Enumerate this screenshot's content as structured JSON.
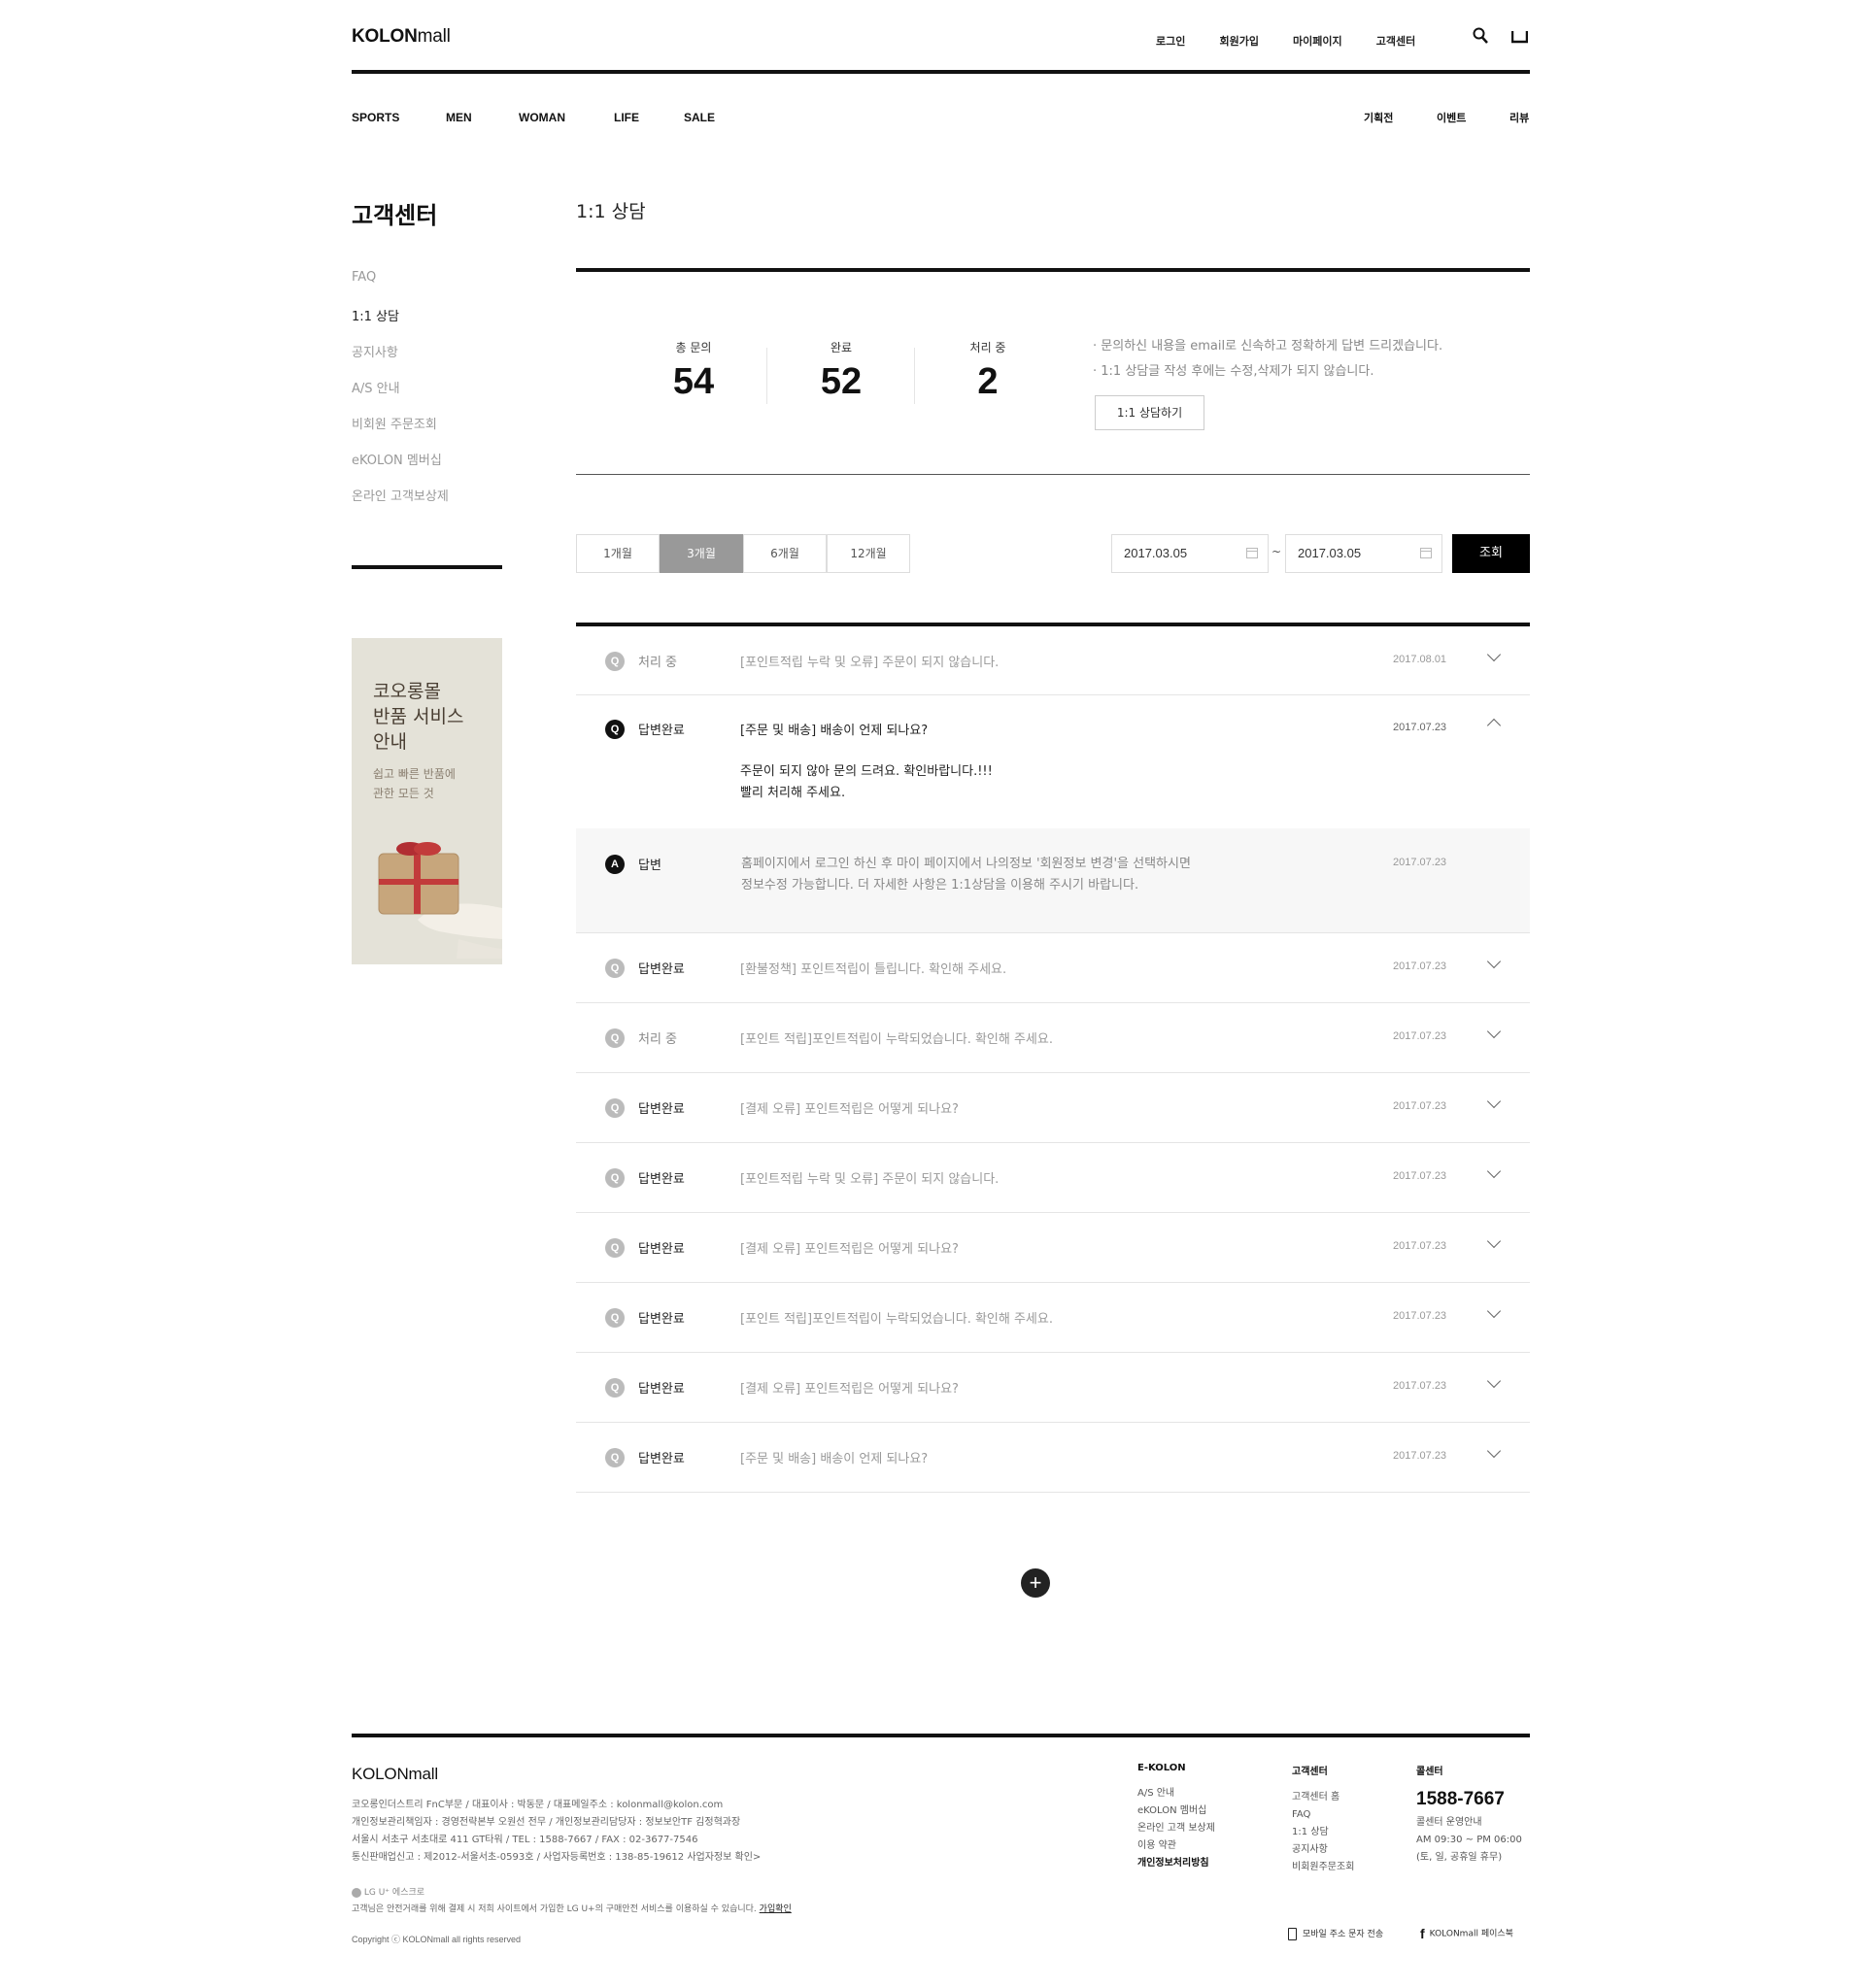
{
  "header": {
    "logo_bold": "KOLON",
    "logo_light": "mall",
    "util": [
      "로그인",
      "회원가입",
      "마이페이지",
      "고객센터"
    ],
    "gnb_left": [
      "SPORTS",
      "MEN",
      "WOMAN",
      "LIFE",
      "SALE"
    ],
    "gnb_right": [
      "기획전",
      "이벤트",
      "리뷰"
    ]
  },
  "sidebar": {
    "title": "고객센터",
    "items": [
      "FAQ",
      "1:1 상담",
      "공지사항",
      "A/S 안내",
      "비회원 주문조회",
      "eKOLON 멤버십",
      "온라인 고객보상제"
    ],
    "active_index": 1,
    "banner": {
      "title_lines": [
        "코오롱몰",
        "반품 서비스",
        "안내"
      ],
      "sub_lines": [
        "쉽고 빠른 반품에",
        "관한 모든 것"
      ]
    }
  },
  "main": {
    "title": "1:1 상담",
    "stats": [
      {
        "label": "총 문의",
        "value": "54"
      },
      {
        "label": "완료",
        "value": "52"
      },
      {
        "label": "처리 중",
        "value": "2"
      }
    ],
    "notices": [
      "· 문의하신 내용을 email로 신속하고 정확하게 답변 드리겠습니다.",
      "· 1:1 상담글 작성 후에는 수정,삭제가 되지 않습니다."
    ],
    "consult_button": "1:1 상담하기",
    "periods": [
      "1개월",
      "3개월",
      "6개월",
      "12개월"
    ],
    "active_period": 1,
    "date_from": "2017.03.05",
    "date_to": "2017.03.05",
    "tilde": "~",
    "search_button": "조회",
    "q_letter": "Q",
    "a_letter": "A",
    "items": [
      {
        "status": "처리 중",
        "title": "[포인트적립 누락 및 오류] 주문이 되지 않습니다.",
        "date": "2017.08.01"
      },
      {
        "status": "답변완료",
        "title": "[주문 및 배송] 배송이 언제 되나요?",
        "date": "2017.07.23",
        "body_lines": [
          "주문이 되지 않아  문의 드려요. 확인바랍니다.!!!",
          "빨리 처리해 주세요."
        ],
        "answer": {
          "label": "답변",
          "lines": [
            "홈페이지에서 로그인 하신 후 마이 페이지에서 나의정보 '회원정보 변경'을 선택하시면",
            "정보수정 가능합니다. 더 자세한 사항은 1:1상담을 이용해 주시기 바랍니다."
          ],
          "date": "2017.07.23"
        }
      },
      {
        "status": "답변완료",
        "title": "[환불정책] 포인트적립이 틀립니다. 확인해 주세요.",
        "date": "2017.07.23"
      },
      {
        "status": "처리 중",
        "title": "[포인트 적립]포인트적립이 누락되었습니다. 확인해 주세요.",
        "date": "2017.07.23"
      },
      {
        "status": "답변완료",
        "title": "[결제 오류] 포인트적립은 어떻게 되나요?",
        "date": "2017.07.23"
      },
      {
        "status": "답변완료",
        "title": "[포인트적립 누락 및 오류] 주문이 되지 않습니다.",
        "date": "2017.07.23"
      },
      {
        "status": "답변완료",
        "title": "[결제 오류] 포인트적립은 어떻게 되나요?",
        "date": "2017.07.23"
      },
      {
        "status": "답변완료",
        "title": "[포인트 적립]포인트적립이 누락되었습니다. 확인해 주세요.",
        "date": "2017.07.23"
      },
      {
        "status": "답변완료",
        "title": "[결제 오류] 포인트적립은 어떻게 되나요?",
        "date": "2017.07.23"
      },
      {
        "status": "답변완료",
        "title": "[주문 및 배송] 배송이 언제 되나요?",
        "date": "2017.07.23"
      }
    ],
    "more_symbol": "+"
  },
  "footer": {
    "company_lines": [
      "코오롱인더스트리 FnC부문 / 대표이사 : 박동문 / 대표메일주소 : kolonmall@kolon.com",
      "개인정보관리책임자 : 경영전략본부 오원선 전무 / 개인정보관리담당자 : 정보보안TF 김정혁과장",
      "서울시 서초구 서초대로 411 GT타워 / TEL : 1588-7667 / FAX : 02-3677-7546",
      "통신판매업신고 : 제2012-서울서초-0593호 / 사업자등록번호 : 138-85-19612  사업자정보 확인>"
    ],
    "escrow_label": "LG U⁺ 에스크로",
    "escrow_text": "고객님은 안전거래를 위해 결제 시 저희 사이트에서 가입한 LG U+의 구매안전 서비스를 이용하실 수 있습니다.",
    "escrow_link": "가입확인",
    "copyright": "Copyright ⓒ KOLONmall all rights reserved",
    "col1": {
      "heading": "E-KOLON",
      "links": [
        "A/S 안내",
        "eKOLON 멤버십",
        "온라인 고객 보상제",
        "이용 약관",
        "개인정보처리방침"
      ]
    },
    "col2": {
      "heading": "고객센터",
      "links": [
        "고객센터 홈",
        "FAQ",
        "1:1 상담",
        "공지사항",
        "비회원주문조회"
      ]
    },
    "col3": {
      "heading": "콜센터",
      "phone": "1588-7667",
      "hours": [
        "콜센터 운영안내",
        "AM 09:30 ~ PM 06:00",
        "(토, 일, 공휴일 휴무)"
      ]
    },
    "mobile_link": "모바일 주소 문자 전송",
    "facebook_link": "KOLONmall 페이스북"
  }
}
